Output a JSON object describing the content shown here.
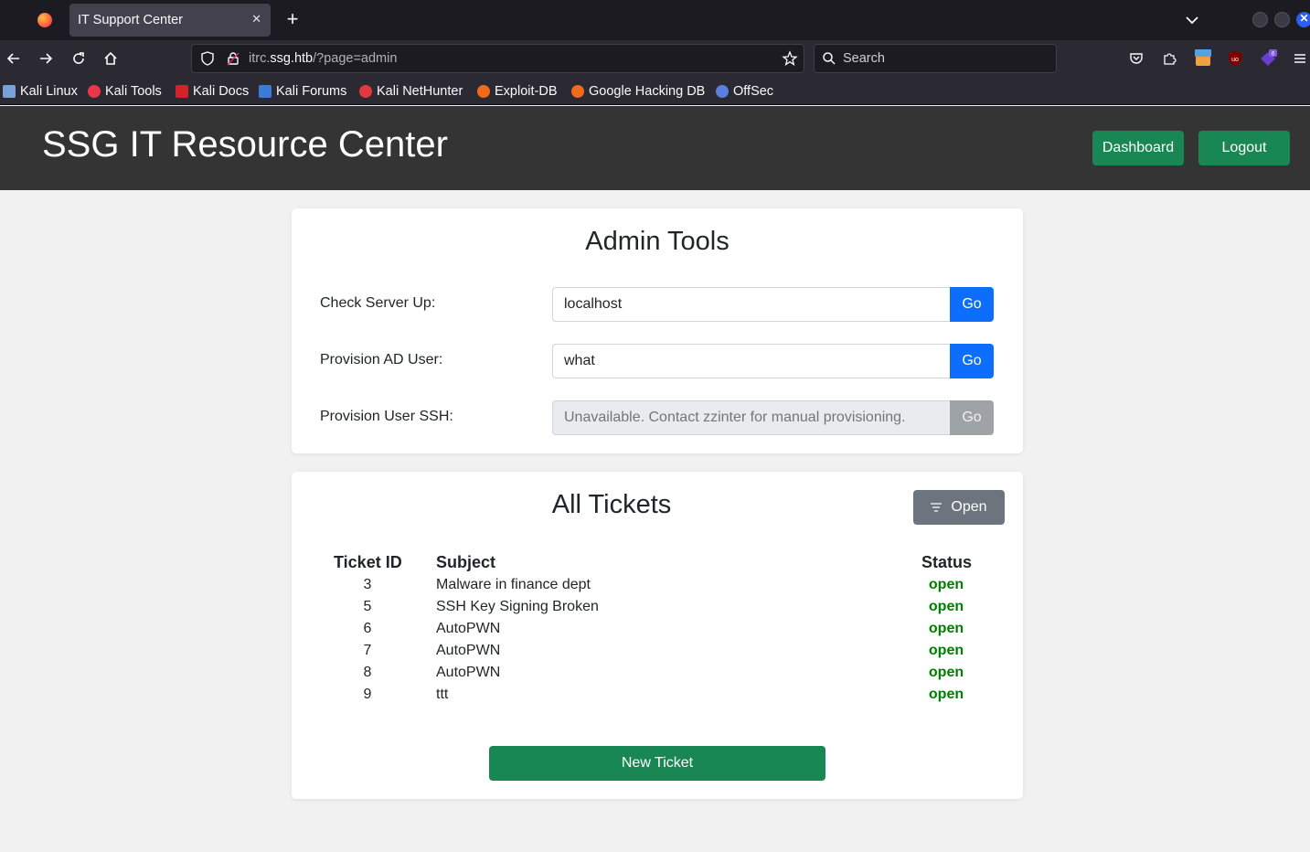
{
  "browser": {
    "tab_title": "IT Support Center",
    "url_host_prefix": "itrc.",
    "url_host_main": "ssg.htb",
    "url_path": "/?page=admin",
    "search_placeholder": "Search",
    "bookmarks": [
      {
        "label": "Kali Linux",
        "color": "#367bf0"
      },
      {
        "label": "Kali Tools",
        "color": "#e8364a"
      },
      {
        "label": "Kali Docs",
        "color": "#d0232a"
      },
      {
        "label": "Kali Forums",
        "color": "#3a7bd5"
      },
      {
        "label": "Kali NetHunter",
        "color": "#e03a3e"
      },
      {
        "label": "Exploit-DB",
        "color": "#f06a1b"
      },
      {
        "label": "Google Hacking DB",
        "color": "#f06a1b"
      },
      {
        "label": "OffSec",
        "color": "#5a7fe0"
      }
    ],
    "extension_badges": {
      "burp": "burp",
      "ublock": "uo",
      "notif": "6"
    }
  },
  "header": {
    "title": "SSG IT Resource Center",
    "dashboard_label": "Dashboard",
    "logout_label": "Logout"
  },
  "admin": {
    "title": "Admin Tools",
    "rows": [
      {
        "label": "Check Server Up:",
        "value": "localhost",
        "placeholder": "",
        "button": "Go",
        "disabled": false
      },
      {
        "label": "Provision AD User:",
        "value": "what",
        "placeholder": "",
        "button": "Go",
        "disabled": false
      },
      {
        "label": "Provision User SSH:",
        "value": "",
        "placeholder": "Unavailable. Contact zzinter for manual provisioning.",
        "button": "Go",
        "disabled": true
      }
    ]
  },
  "tickets": {
    "title": "All Tickets",
    "filter_label": "Open",
    "columns": {
      "id": "Ticket ID",
      "subject": "Subject",
      "status": "Status"
    },
    "rows": [
      {
        "id": "3",
        "subject": "Malware in finance dept",
        "status": "open"
      },
      {
        "id": "5",
        "subject": "SSH Key Signing Broken",
        "status": "open"
      },
      {
        "id": "6",
        "subject": "AutoPWN",
        "status": "open"
      },
      {
        "id": "7",
        "subject": "AutoPWN",
        "status": "open"
      },
      {
        "id": "8",
        "subject": "AutoPWN",
        "status": "open"
      },
      {
        "id": "9",
        "subject": "ttt",
        "status": "open"
      }
    ],
    "new_ticket_label": "New Ticket"
  },
  "colors": {
    "header_bg": "#343434",
    "success": "#198754",
    "primary": "#0d6efd",
    "status_open": "#008000"
  }
}
